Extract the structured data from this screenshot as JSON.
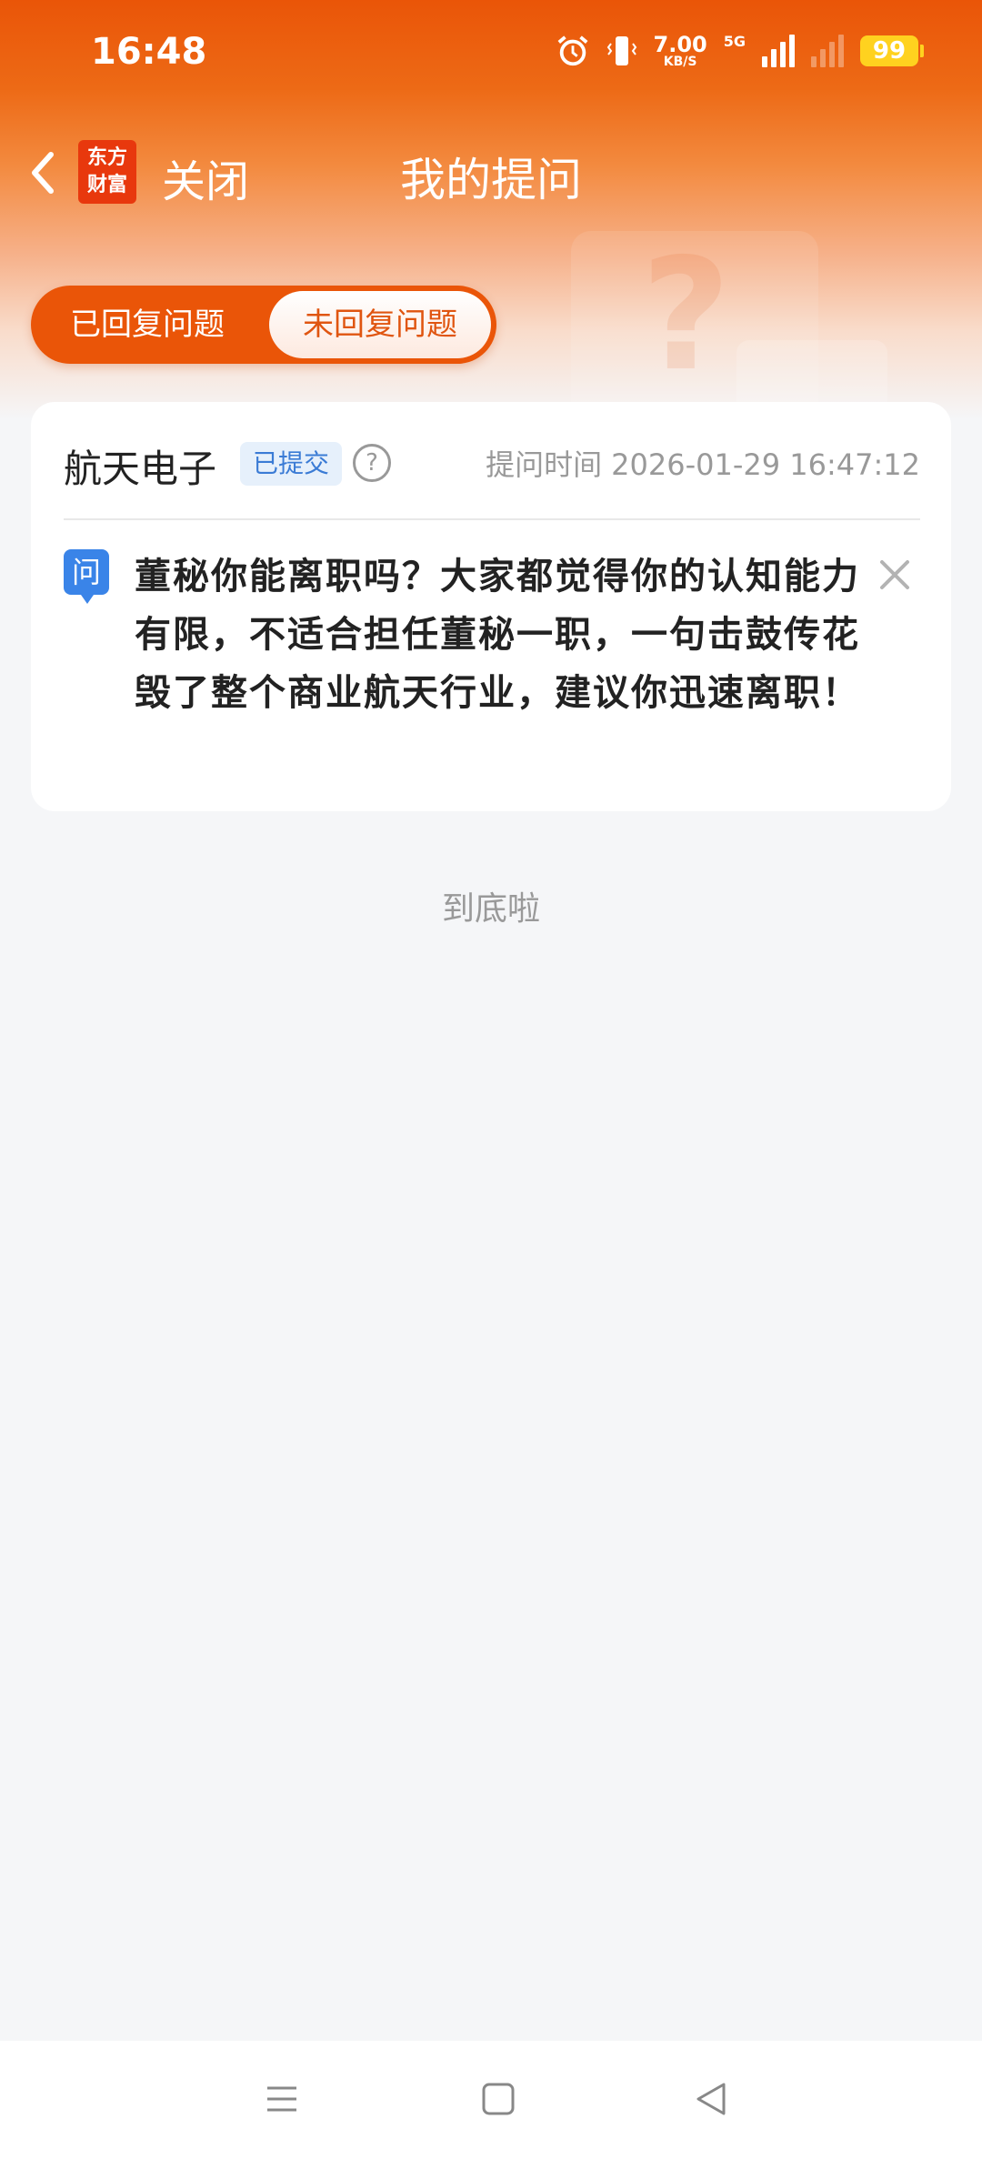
{
  "status": {
    "time": "16:48",
    "speed_value": "7.00",
    "speed_unit": "KB/S",
    "network": "5G",
    "battery": "99"
  },
  "nav": {
    "logo_line1": "东方",
    "logo_line2": "财富",
    "close_label": "关闭",
    "title": "我的提问"
  },
  "tabs": {
    "replied": "已回复问题",
    "unreplied": "未回复问题"
  },
  "card": {
    "company": "航天电子",
    "badge": "已提交",
    "help": "?",
    "time_label": "提问时间",
    "time_value": "2026-01-29 16:47:12",
    "q_icon": "问",
    "question": "董秘你能离职吗？大家都觉得你的认知能力有限，不适合担任董秘一职，一句击鼓传花毁了整个商业航天行业，建议你迅速离职！"
  },
  "end_text": "到底啦",
  "colors": {
    "brand": "#ea5508",
    "badge_blue": "#3a7bd5",
    "question_icon_blue": "#3a84e8"
  }
}
